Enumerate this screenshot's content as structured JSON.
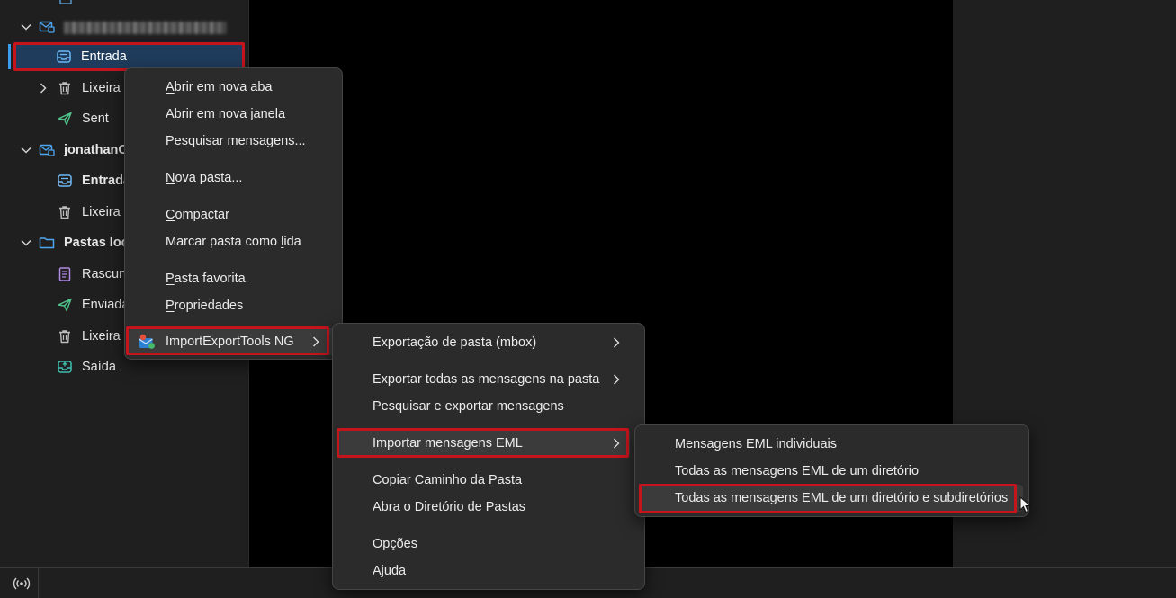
{
  "folder_tree": {
    "account1": {
      "label": ""
    },
    "items": [
      {
        "label": "Entrada",
        "bold": false
      },
      {
        "label": "Lixeira",
        "bold": false
      },
      {
        "label": "Sent",
        "bold": false
      },
      {
        "label": "jonathanC",
        "bold": true
      },
      {
        "label": "Entrada",
        "bold": true
      },
      {
        "label": "Lixeira",
        "bold": false
      },
      {
        "label": "Pastas loc",
        "bold": true
      },
      {
        "label": "Rascun",
        "bold": false
      },
      {
        "label": "Enviada",
        "bold": false
      },
      {
        "label": "Lixeira",
        "bold": false
      },
      {
        "label": "Saída",
        "bold": false
      }
    ]
  },
  "context_menu": {
    "items": [
      {
        "pre": "",
        "u": "A",
        "post": "brir em nova aba"
      },
      {
        "pre": "Abrir em ",
        "u": "n",
        "post": "ova janela"
      },
      {
        "pre": "P",
        "u": "e",
        "post": "squisar mensagens..."
      },
      {
        "pre": "",
        "u": "N",
        "post": "ova pasta..."
      },
      {
        "pre": "",
        "u": "C",
        "post": "ompactar"
      },
      {
        "pre": "Marcar pasta como ",
        "u": "l",
        "post": "ida"
      },
      {
        "pre": "",
        "u": "P",
        "post": "asta favorita"
      },
      {
        "pre": "",
        "u": "P",
        "post": "ropriedades"
      },
      {
        "pre": "",
        "u": "",
        "post": "ImportExportTools NG"
      }
    ]
  },
  "submenu_ietng": {
    "items": [
      "Exportação de pasta (mbox)",
      "Exportar todas as mensagens na pasta",
      "Pesquisar e exportar mensagens",
      "Importar mensagens EML",
      "Copiar Caminho da Pasta",
      "Abra o Diretório de Pastas",
      "Opções",
      "Ajuda"
    ]
  },
  "submenu_import_eml": {
    "items": [
      "Mensagens EML individuais",
      "Todas as mensagens EML de um diretório",
      "Todas as mensagens EML de um diretório e subdiretórios"
    ]
  },
  "icons": {
    "status": "radio-waves-icon",
    "account": "mail-account-icon",
    "inbox": "inbox-icon",
    "trash": "trash-icon",
    "sent": "paper-plane-icon",
    "folder": "folder-icon",
    "drafts": "drafts-icon",
    "outbox": "outbox-icon",
    "addon": "import-export-addon-icon"
  },
  "colors": {
    "accent": "#3a9df0",
    "highlight_box": "#c6141d",
    "menu_bg": "#2b2b2b"
  }
}
